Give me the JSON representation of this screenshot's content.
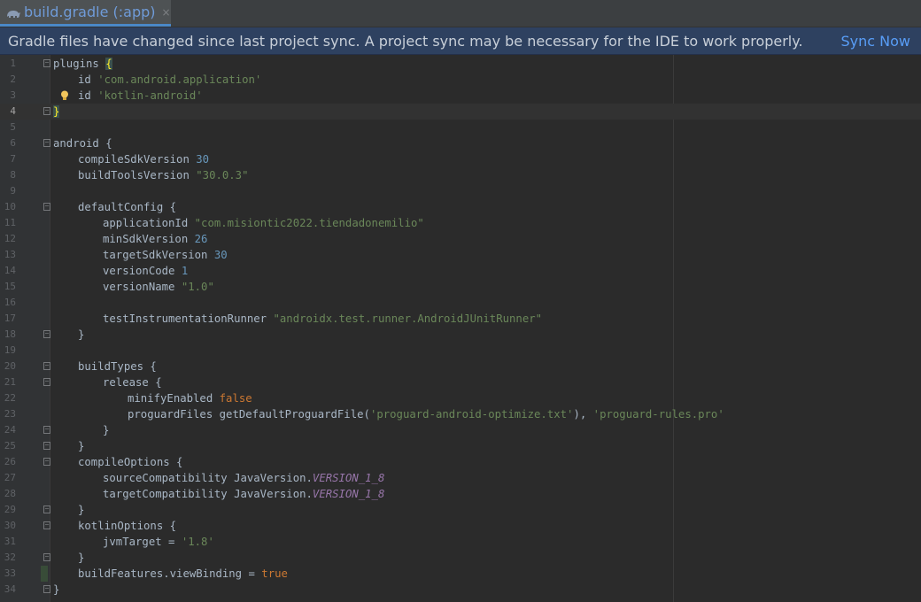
{
  "tab": {
    "title": "build.gradle (:app)",
    "icon": "gradle-elephant-icon",
    "close_glyph": "×"
  },
  "banner": {
    "message": "Gradle files have changed since last project sync. A project sync may be necessary for the IDE to work properly.",
    "action": "Sync Now"
  },
  "editor": {
    "current_line": 4,
    "lines": [
      {
        "n": "1",
        "indent": 0,
        "fold": "open",
        "tokens": [
          [
            "ident",
            "plugins "
          ],
          [
            "brace-hl",
            "{"
          ]
        ]
      },
      {
        "n": "2",
        "indent": 1,
        "tokens": [
          [
            "ident",
            "id "
          ],
          [
            "str",
            "'com.android.application'"
          ]
        ]
      },
      {
        "n": "3",
        "indent": 1,
        "bulb": true,
        "tokens": [
          [
            "ident",
            "id "
          ],
          [
            "str",
            "'kotlin-android'"
          ]
        ]
      },
      {
        "n": "4",
        "indent": 0,
        "fold": "close",
        "tokens": [
          [
            "brace-hl",
            "}"
          ]
        ]
      },
      {
        "n": "5",
        "indent": 0,
        "tokens": []
      },
      {
        "n": "6",
        "indent": 0,
        "fold": "open",
        "tokens": [
          [
            "ident",
            "android {"
          ]
        ]
      },
      {
        "n": "7",
        "indent": 1,
        "tokens": [
          [
            "ident",
            "compileSdkVersion "
          ],
          [
            "num",
            "30"
          ]
        ]
      },
      {
        "n": "8",
        "indent": 1,
        "tokens": [
          [
            "ident",
            "buildToolsVersion "
          ],
          [
            "str",
            "\"30.0.3\""
          ]
        ]
      },
      {
        "n": "9",
        "indent": 0,
        "tokens": []
      },
      {
        "n": "10",
        "indent": 1,
        "fold": "open",
        "tokens": [
          [
            "ident",
            "defaultConfig {"
          ]
        ]
      },
      {
        "n": "11",
        "indent": 2,
        "tokens": [
          [
            "ident",
            "applicationId "
          ],
          [
            "str",
            "\"com.misiontic2022.tiendadonemilio\""
          ]
        ]
      },
      {
        "n": "12",
        "indent": 2,
        "tokens": [
          [
            "ident",
            "minSdkVersion "
          ],
          [
            "num",
            "26"
          ]
        ]
      },
      {
        "n": "13",
        "indent": 2,
        "tokens": [
          [
            "ident",
            "targetSdkVersion "
          ],
          [
            "num",
            "30"
          ]
        ]
      },
      {
        "n": "14",
        "indent": 2,
        "tokens": [
          [
            "ident",
            "versionCode "
          ],
          [
            "num",
            "1"
          ]
        ]
      },
      {
        "n": "15",
        "indent": 2,
        "tokens": [
          [
            "ident",
            "versionName "
          ],
          [
            "str",
            "\"1.0\""
          ]
        ]
      },
      {
        "n": "16",
        "indent": 0,
        "tokens": []
      },
      {
        "n": "17",
        "indent": 2,
        "tokens": [
          [
            "ident",
            "testInstrumentationRunner "
          ],
          [
            "str",
            "\"androidx.test.runner.AndroidJUnitRunner\""
          ]
        ]
      },
      {
        "n": "18",
        "indent": 1,
        "fold": "close",
        "tokens": [
          [
            "ident",
            "}"
          ]
        ]
      },
      {
        "n": "19",
        "indent": 0,
        "tokens": []
      },
      {
        "n": "20",
        "indent": 1,
        "fold": "open",
        "tokens": [
          [
            "ident",
            "buildTypes {"
          ]
        ]
      },
      {
        "n": "21",
        "indent": 2,
        "fold": "open",
        "tokens": [
          [
            "ident",
            "release {"
          ]
        ]
      },
      {
        "n": "22",
        "indent": 3,
        "tokens": [
          [
            "ident",
            "minifyEnabled "
          ],
          [
            "kw",
            "false"
          ]
        ]
      },
      {
        "n": "23",
        "indent": 3,
        "tokens": [
          [
            "ident",
            "proguardFiles getDefaultProguardFile("
          ],
          [
            "str",
            "'proguard-android-optimize.txt'"
          ],
          [
            "ident",
            "), "
          ],
          [
            "str",
            "'proguard-rules.pro'"
          ]
        ]
      },
      {
        "n": "24",
        "indent": 2,
        "fold": "close",
        "tokens": [
          [
            "ident",
            "}"
          ]
        ]
      },
      {
        "n": "25",
        "indent": 1,
        "fold": "close",
        "tokens": [
          [
            "ident",
            "}"
          ]
        ]
      },
      {
        "n": "26",
        "indent": 1,
        "fold": "open",
        "tokens": [
          [
            "ident",
            "compileOptions {"
          ]
        ]
      },
      {
        "n": "27",
        "indent": 2,
        "tokens": [
          [
            "ident",
            "sourceCompatibility JavaVersion."
          ],
          [
            "italic",
            "VERSION_1_8"
          ]
        ]
      },
      {
        "n": "28",
        "indent": 2,
        "tokens": [
          [
            "ident",
            "targetCompatibility JavaVersion."
          ],
          [
            "italic",
            "VERSION_1_8"
          ]
        ]
      },
      {
        "n": "29",
        "indent": 1,
        "fold": "close",
        "tokens": [
          [
            "ident",
            "}"
          ]
        ]
      },
      {
        "n": "30",
        "indent": 1,
        "fold": "open",
        "tokens": [
          [
            "ident",
            "kotlinOptions {"
          ]
        ]
      },
      {
        "n": "31",
        "indent": 2,
        "tokens": [
          [
            "ident",
            "jvmTarget = "
          ],
          [
            "str",
            "'1.8'"
          ]
        ]
      },
      {
        "n": "32",
        "indent": 1,
        "fold": "close",
        "tokens": [
          [
            "ident",
            "}"
          ]
        ]
      },
      {
        "n": "33",
        "indent": 1,
        "changed": true,
        "tokens": [
          [
            "ident",
            "buildFeatures.viewBinding = "
          ],
          [
            "kw",
            "true"
          ]
        ]
      },
      {
        "n": "34",
        "indent": 0,
        "fold": "close",
        "tokens": [
          [
            "ident",
            "}"
          ]
        ]
      }
    ]
  }
}
